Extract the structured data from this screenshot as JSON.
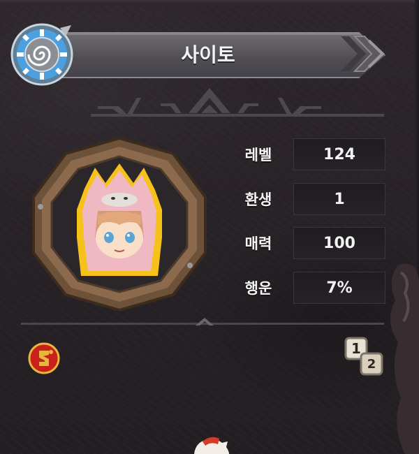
{
  "character": {
    "name": "사이토"
  },
  "stats": [
    {
      "label": "레벨",
      "value": "124"
    },
    {
      "label": "환생",
      "value": "1"
    },
    {
      "label": "매력",
      "value": "100"
    },
    {
      "label": "행운",
      "value": "7%"
    }
  ],
  "page_toggle": {
    "current": "1",
    "next": "2"
  },
  "icons": {
    "medallion": "spiral-medallion-icon",
    "badge": "red-emblem-icon"
  },
  "colors": {
    "banner": "#5a585d",
    "frame_wood": "#8b6a4e",
    "portrait_glow": "#f6c21a",
    "value_box": "#1f1c20"
  }
}
